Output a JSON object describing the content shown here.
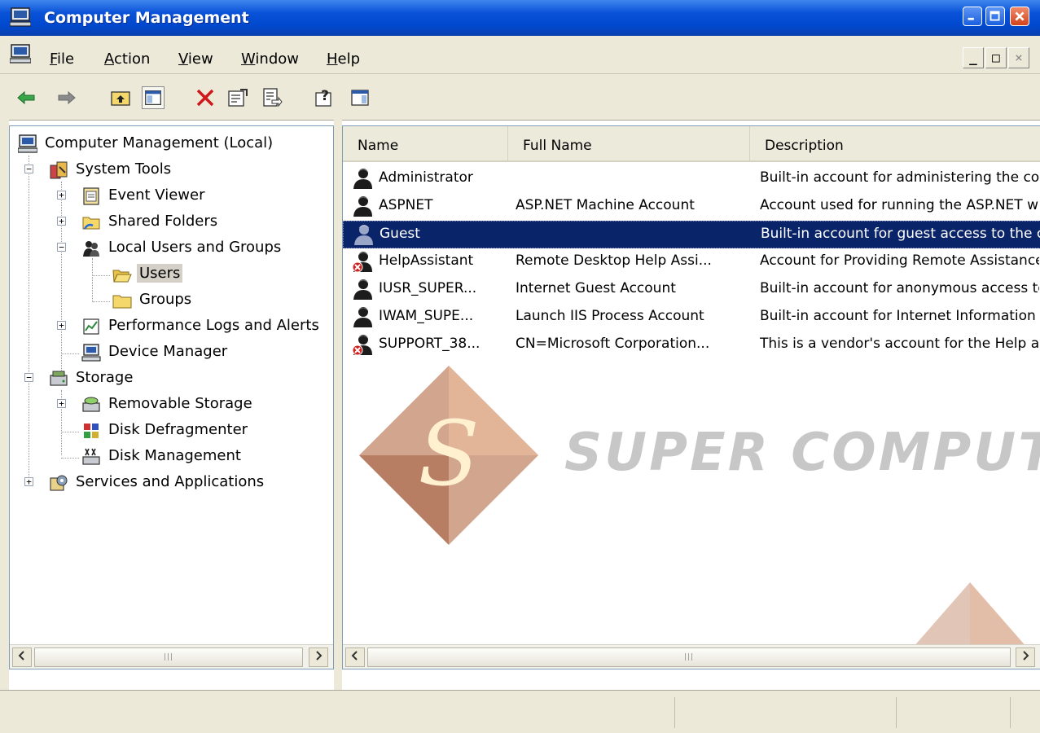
{
  "window": {
    "title": "Computer Management"
  },
  "menu": {
    "items": [
      "File",
      "Action",
      "View",
      "Window",
      "Help"
    ]
  },
  "mdi_buttons": {
    "minimize": "_",
    "restore": "□",
    "close": "×"
  },
  "toolbar": {
    "buttons": [
      "back-icon",
      "forward-icon",
      "up-one-level-icon",
      "show-hide-console-tree-icon",
      "delete-icon",
      "properties-icon",
      "export-list-icon",
      "help-icon",
      "show-hide-action-pane-icon"
    ]
  },
  "tree": {
    "root": "Computer Management (Local)",
    "system_tools": "System Tools",
    "event_viewer": "Event Viewer",
    "shared_folders": "Shared Folders",
    "local_users_groups": "Local Users and Groups",
    "users": "Users",
    "groups": "Groups",
    "perf_logs": "Performance Logs and Alerts",
    "device_manager": "Device Manager",
    "storage": "Storage",
    "removable_storage": "Removable Storage",
    "disk_defrag": "Disk Defragmenter",
    "disk_management": "Disk Management",
    "services_apps": "Services and Applications"
  },
  "list": {
    "columns": [
      "Name",
      "Full Name",
      "Description"
    ],
    "rows": [
      {
        "name": "Administrator",
        "full_name": "",
        "description": "Built-in account for administering the computer/domain",
        "disabled": false
      },
      {
        "name": "ASPNET",
        "full_name": "ASP.NET Machine Account",
        "description": "Account used for running the ASP.NET worker process",
        "disabled": false
      },
      {
        "name": "Guest",
        "full_name": "",
        "description": "Built-in account for guest access to the computer/domain",
        "disabled": false
      },
      {
        "name": "HelpAssistant",
        "full_name": "Remote Desktop Help Assi...",
        "description": "Account for Providing Remote Assistance",
        "disabled": true
      },
      {
        "name": "IUSR_SUPER...",
        "full_name": "Internet Guest Account",
        "description": "Built-in account for anonymous access to IIS",
        "disabled": false
      },
      {
        "name": "IWAM_SUPE...",
        "full_name": "Launch IIS Process Account",
        "description": "Built-in account for Internet Information Services",
        "disabled": false
      },
      {
        "name": "SUPPORT_38...",
        "full_name": "CN=Microsoft Corporation...",
        "description": "This is a vendor's account for the Help and Support Service",
        "disabled": true
      }
    ],
    "selected_index": 2
  },
  "watermark": {
    "text": "SUPER COMPUTER",
    "logo_letter": "S"
  },
  "colors": {
    "titlebar": "#0a53d8",
    "selection": "#0a246a",
    "chrome": "#ece9d8"
  }
}
